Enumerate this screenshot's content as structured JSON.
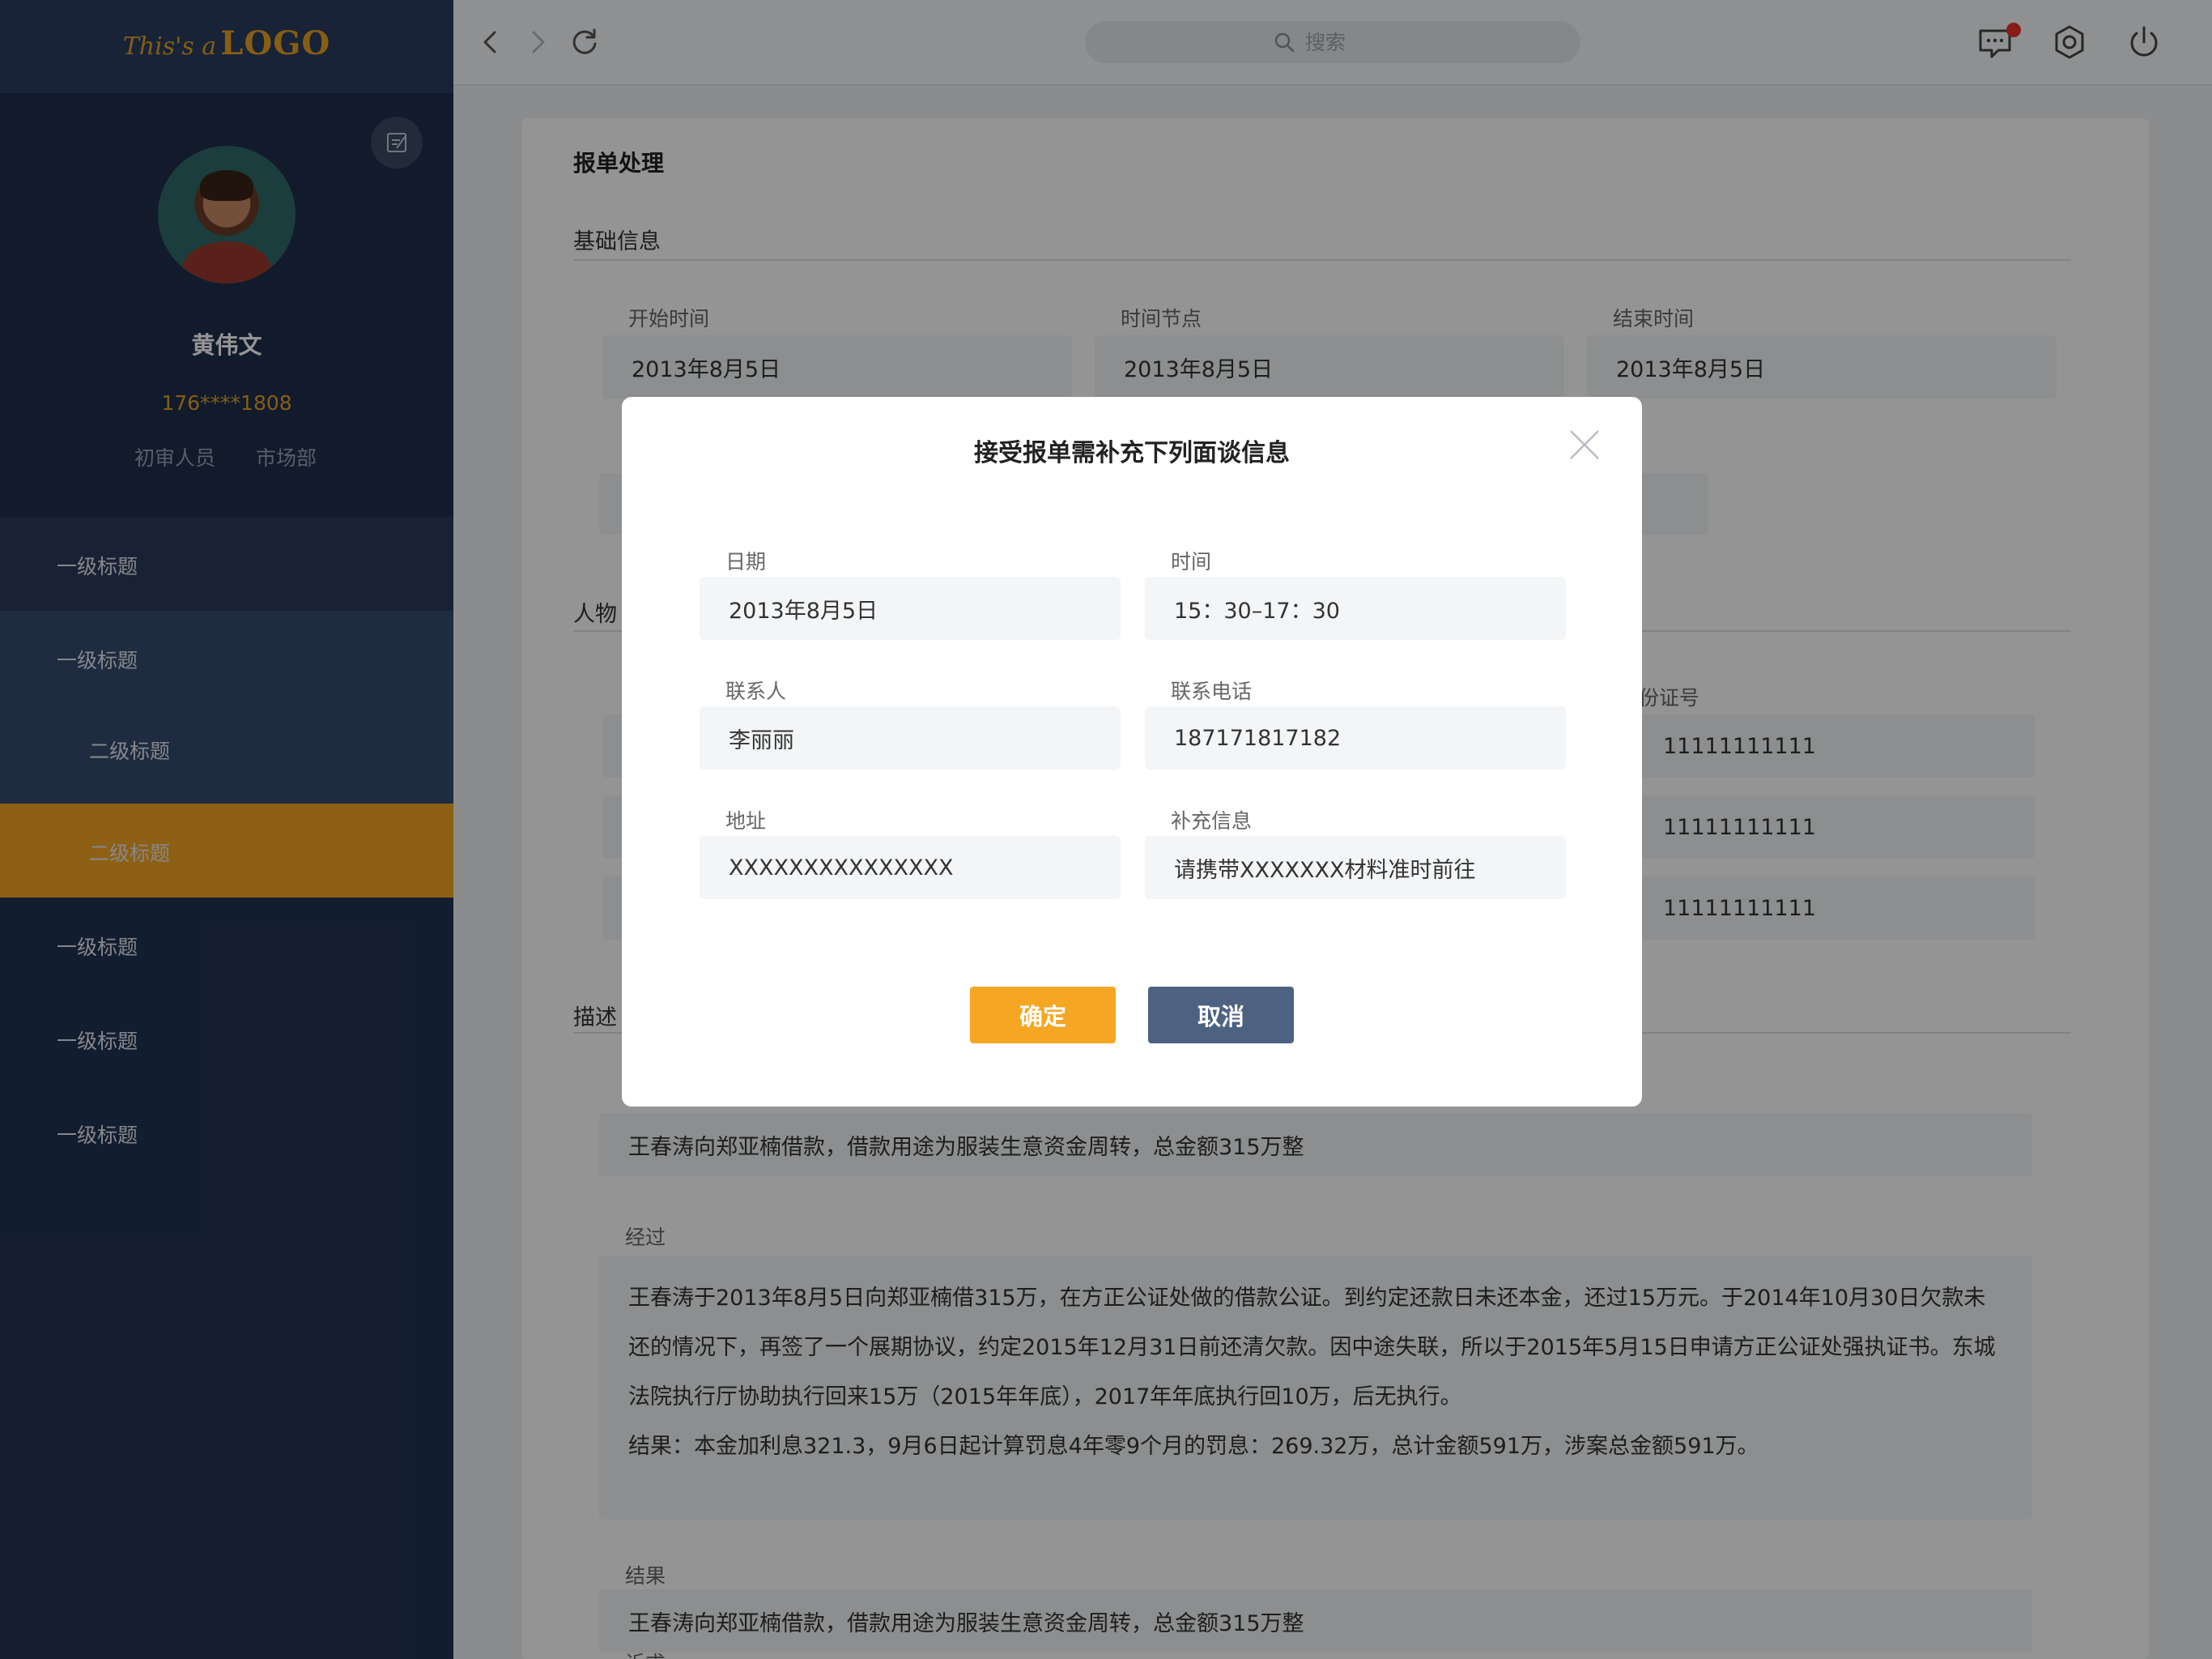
{
  "logo": {
    "script_text": "This's a",
    "bold_text": "LOGO"
  },
  "profile": {
    "name": "黄伟文",
    "phone": "176****1808",
    "role": "初审人员",
    "department": "市场部"
  },
  "nav": {
    "item1": "一级标题",
    "item2": "一级标题",
    "item2_sub": "二级标题",
    "active": "二级标题",
    "item3": "一级标题",
    "item4": "一级标题",
    "item5": "一级标题"
  },
  "topbar": {
    "search_placeholder": "搜索"
  },
  "main": {
    "page_title": "报单处理",
    "basic_section": "基础信息",
    "start_time_label": "开始时间",
    "start_time_value": "2013年8月5日",
    "time_node_label": "时间节点",
    "time_node_value": "2013年8月5日",
    "end_time_label": "结束时间",
    "end_time_value": "2013年8月5日",
    "person_section_partial": "人物",
    "id_label_partial": "份证号",
    "id_row1_partial": "11111111111",
    "id_row2_partial": "11111111111",
    "id_row3_partial": "11111111111",
    "desc_section_partial": "描述",
    "summary_value": "王春涛向郑亚楠借款，借款用途为服装生意资金周转，总金额315万整",
    "process_label": "经过",
    "process_value": "王春涛于2013年8月5日向郑亚楠借315万，在方正公证处做的借款公证。到约定还款日未还本金，还过15万元。于2014年10月30日欠款未还的情况下，再签了一个展期协议，约定2015年12月31日前还清欠款。因中途失联，所以于2015年5月15日申请方正公证处强执证书。东城法院执行厅协助执行回来15万（2015年年底），2017年年底执行回10万，后无执行。",
    "process_result_line": "结果：本金加利息321.3，9月6日起计算罚息4年零9个月的罚息：269.32万，总计金额591万，涉案总金额591万。",
    "result_label": "结果",
    "result_value": "王春涛向郑亚楠借款，借款用途为服装生意资金周转，总金额315万整",
    "last_label_partial": "诉求"
  },
  "modal": {
    "title": "接受报单需补充下列面谈信息",
    "date_label": "日期",
    "date_value": "2013年8月5日",
    "time_label": "时间",
    "time_value": "15：30–17：30",
    "contact_label": "联系人",
    "contact_value": "李丽丽",
    "phone_label": "联系电话",
    "phone_value": "187171817182",
    "address_label": "地址",
    "address_value": "XXXXXXXXXXXXXXX",
    "extra_label": "补充信息",
    "extra_value": "请携带XXXXXXX材料准时前往",
    "confirm_label": "确定",
    "cancel_label": "取消"
  },
  "colors": {
    "sidebar_bg": "#223353",
    "accent_orange": "#f5a623",
    "cancel_button": "#4d6181",
    "notification_dot": "#e8322c"
  },
  "icons": [
    "back-icon",
    "forward-icon",
    "refresh-icon",
    "search-icon",
    "message-icon",
    "settings-icon",
    "power-icon",
    "edit-icon",
    "close-icon"
  ]
}
